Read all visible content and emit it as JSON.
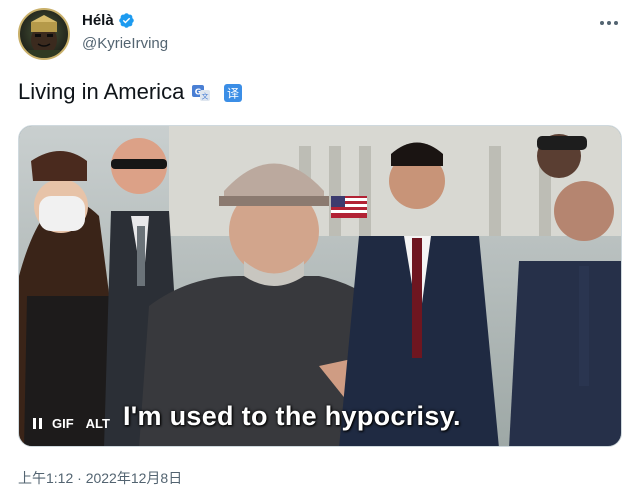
{
  "author": {
    "display_name": "Hélà",
    "handle": "@KyrieIrving",
    "verified_icon": "verified-badge-icon",
    "verified_color": "#1d9bf0"
  },
  "more_menu_icon": "more-horizontal-icon",
  "tweet": {
    "text": "Living in America",
    "emoji_1": "translate-emoji-icon",
    "emoji_2": "chinese-translate-emoji-icon"
  },
  "media": {
    "caption": "I'm used to the hypocrisy.",
    "gif_label": "GIF",
    "alt_label": "ALT",
    "pause_icon": "pause-icon"
  },
  "timestamp": "上午1:12 · 2022年12月8日"
}
